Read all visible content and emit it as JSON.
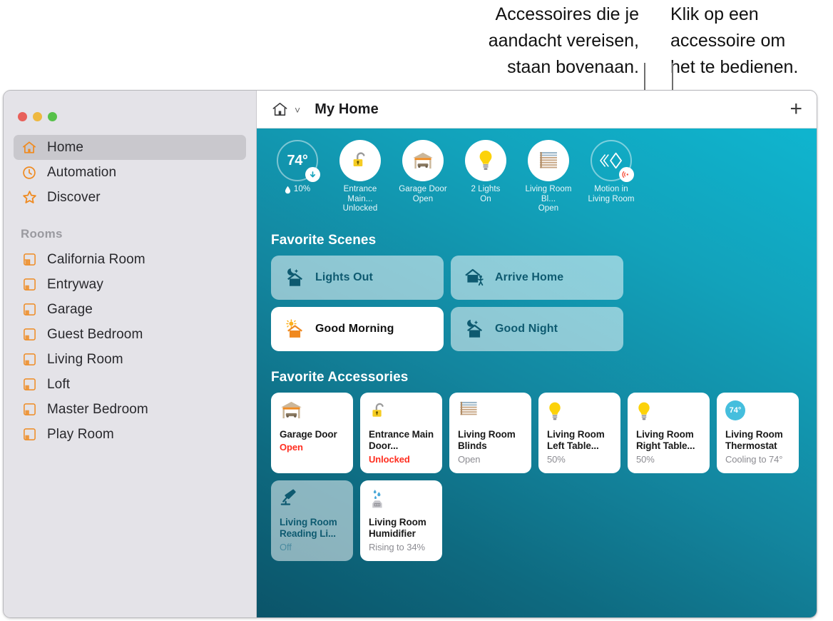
{
  "callouts": {
    "left": "Accessoires die je\naandacht vereisen,\nstaan bovenaan.",
    "right": "Klik op een\naccessoire om\nhet te bedienen."
  },
  "window": {
    "traffic": {
      "close": "close-button",
      "minimize": "minimize-button",
      "zoom": "zoom-button"
    }
  },
  "sidebar": {
    "items": [
      {
        "label": "Home",
        "icon": "house-icon",
        "selected": true
      },
      {
        "label": "Automation",
        "icon": "clock-icon",
        "selected": false
      },
      {
        "label": "Discover",
        "icon": "star-icon",
        "selected": false
      }
    ],
    "rooms_header": "Rooms",
    "rooms": [
      {
        "label": "California Room",
        "icon": "room-icon"
      },
      {
        "label": "Entryway",
        "icon": "room-icon"
      },
      {
        "label": "Garage",
        "icon": "room-icon"
      },
      {
        "label": "Guest Bedroom",
        "icon": "room-icon"
      },
      {
        "label": "Living Room",
        "icon": "room-icon"
      },
      {
        "label": "Loft",
        "icon": "room-icon"
      },
      {
        "label": "Master Bedroom",
        "icon": "room-icon"
      },
      {
        "label": "Play Room",
        "icon": "room-icon"
      }
    ]
  },
  "toolbar": {
    "home_icon": "house-icon",
    "chevron": "˅",
    "title": "My Home",
    "add_label": "+"
  },
  "status": {
    "items": [
      {
        "icon": "thermostat-outline",
        "value": "74°",
        "badge": "down-arrow-icon",
        "line1": "10%",
        "line2": "",
        "humidity": true
      },
      {
        "icon": "unlocked-padlock-icon",
        "value": "",
        "badge": "",
        "line1": "Entrance Main...",
        "line2": "Unlocked"
      },
      {
        "icon": "garage-door-icon",
        "value": "",
        "badge": "",
        "line1": "Garage Door",
        "line2": "Open"
      },
      {
        "icon": "lightbulb-icon",
        "value": "",
        "badge": "",
        "line1": "2 Lights",
        "line2": "On"
      },
      {
        "icon": "blinds-icon",
        "value": "",
        "badge": "",
        "line1": "Living Room Bl...",
        "line2": "Open"
      },
      {
        "icon": "motion-sensor-icon",
        "value": "",
        "badge": "motion-wave-icon",
        "line1": "Motion in",
        "line2": "Living Room"
      }
    ]
  },
  "scenes": {
    "title": "Favorite Scenes",
    "items": [
      {
        "label": "Lights Out",
        "icon": "moon-house-icon",
        "active": false
      },
      {
        "label": "Arrive Home",
        "icon": "house-person-icon",
        "active": false
      },
      {
        "label": "Good Morning",
        "icon": "sun-house-icon",
        "active": true
      },
      {
        "label": "Good Night",
        "icon": "moon-house-icon",
        "active": false
      }
    ]
  },
  "accessories": {
    "title": "Favorite Accessories",
    "items": [
      {
        "icon": "garage-door-icon",
        "name": "Garage Door",
        "state": "Open",
        "alert": true,
        "off": false
      },
      {
        "icon": "unlocked-padlock-icon",
        "name": "Entrance Main Door...",
        "state": "Unlocked",
        "alert": true,
        "off": false
      },
      {
        "icon": "blinds-icon",
        "name": "Living Room Blinds",
        "state": "Open",
        "alert": false,
        "off": false
      },
      {
        "icon": "lightbulb-icon",
        "name": "Living Room Left Table...",
        "state": "50%",
        "alert": false,
        "off": false
      },
      {
        "icon": "lightbulb-icon",
        "name": "Living Room Right Table...",
        "state": "50%",
        "alert": false,
        "off": false
      },
      {
        "icon": "thermostat-pill",
        "name": "Living Room Thermostat",
        "state": "Cooling to 74°",
        "alert": false,
        "off": false,
        "pill": "74°"
      },
      {
        "icon": "desk-lamp-icon",
        "name": "Living Room Reading Li...",
        "state": "Off",
        "alert": false,
        "off": true
      },
      {
        "icon": "humidifier-icon",
        "name": "Living Room Humidifier",
        "state": "Rising to 34%",
        "alert": false,
        "off": false
      }
    ]
  },
  "colors": {
    "accent_orange": "#ef8b22",
    "alert_red": "#ff2d1f",
    "scene_teal": "#0e5a70",
    "bg_top": "#0fb5cf",
    "bg_bottom": "#0b5469",
    "thermo_blue": "#45bedd"
  }
}
